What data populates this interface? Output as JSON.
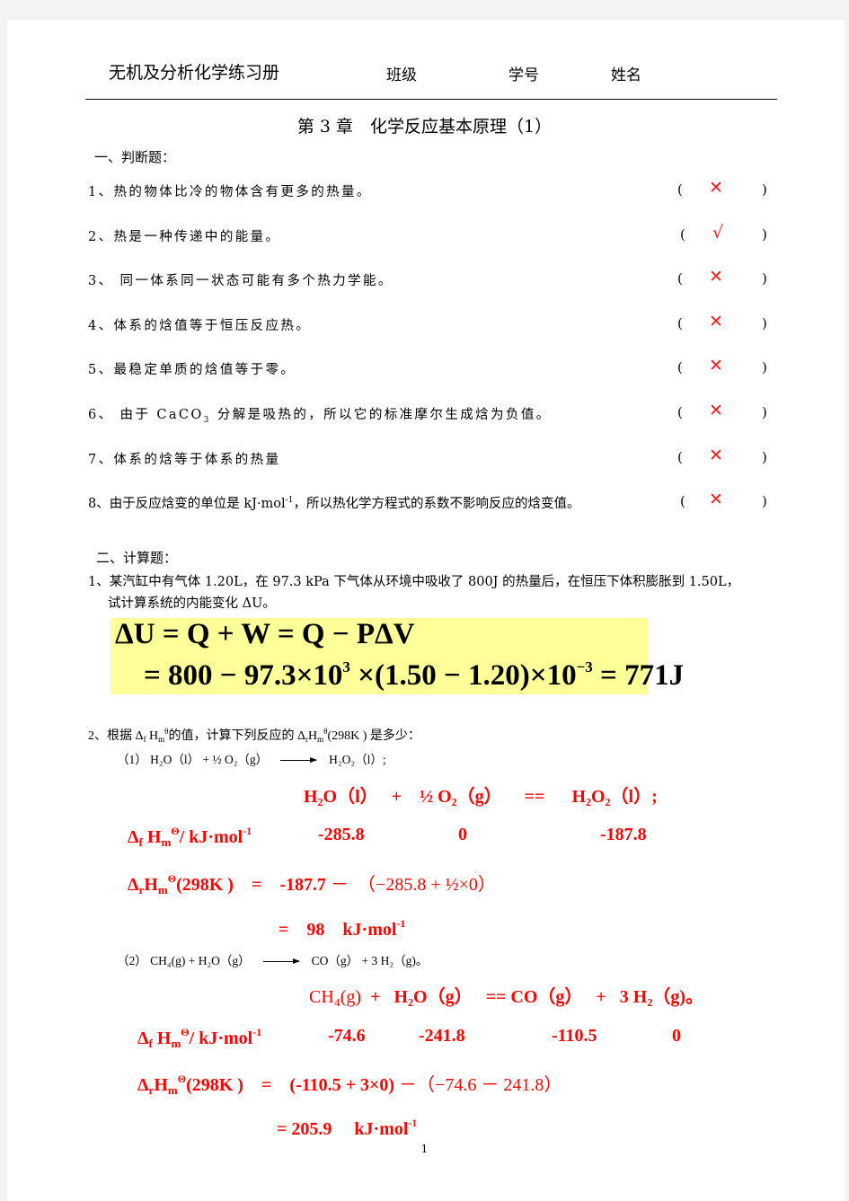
{
  "header": {
    "book_title": "无机及分析化学练习册",
    "class_label": "班级",
    "student_id_label": "学号",
    "name_label": "姓名"
  },
  "chapter_title": "第 3 章　化学反应基本原理（1）",
  "section1": {
    "title": "一、判断题：",
    "items": [
      {
        "num": "1、",
        "text": "热的物体比冷的物体含有更多的热量。",
        "answer": "✕",
        "answer_type": "wrong"
      },
      {
        "num": "2、",
        "text": "热是一种传递中的能量。",
        "answer": "√",
        "answer_type": "right"
      },
      {
        "num": "3、",
        "text": " 同一体系同一状态可能有多个热力学能。",
        "answer": "✕",
        "answer_type": "wrong"
      },
      {
        "num": "4、",
        "text": "体系的焓值等于恒压反应热。",
        "answer": "✕",
        "answer_type": "wrong"
      },
      {
        "num": "5、",
        "text": "最稳定单质的焓值等于零。",
        "answer": "✕",
        "answer_type": "wrong"
      },
      {
        "num": "6、",
        "text_pre": " 由于 CaCO",
        "text_sub": "3",
        "text_post": " 分解是吸热的，所以它的标准摩尔生成焓为负值。",
        "answer": "✕",
        "answer_type": "wrong"
      },
      {
        "num": "7、",
        "text": "体系的焓等于体系的热量",
        "answer": "✕",
        "answer_type": "wrong"
      },
      {
        "num": "8、",
        "text_pre": "由于反应焓变的单位是 kJ·mol",
        "text_sup": "-1",
        "text_post": "，所以热化学方程式的系数不影响反应的焓变值。",
        "answer": "✕",
        "answer_type": "wrong"
      }
    ],
    "paren_open": "(",
    "paren_close": ")"
  },
  "section2": {
    "title": "二、计算题：",
    "q1": {
      "line1": "1、某汽缸中有气体 1.20L，在 97.3  kPa 下气体从环境中吸收了 800J 的热量后，在恒压下体积膨胀到 1.50L，",
      "line2": "试计算系统的内能变化 ΔU。",
      "answer_line1": "ΔU = Q + W = Q − PΔV",
      "answer_line2_a": "= 800 − 97.3×10",
      "answer_line2_exp1": "3",
      "answer_line2_b": " ×(1.50 − 1.20)×10",
      "answer_line2_exp2": "−3",
      "answer_line2_c": " = 771J"
    },
    "q2": {
      "intro_a": "2、根据 Δ",
      "intro_f": "f",
      "intro_b": " H",
      "intro_m": "m",
      "intro_theta": "θ",
      "intro_c": "的值，计算下列反应的 Δ",
      "intro_r": "r",
      "intro_d": "H",
      "intro_e": "(298K )  是多少：",
      "part1": {
        "label": "（1）",
        "reactant1": "H₂O（l）",
        "plus": "+ ½ O₂（g）",
        "product": "H₂O₂（l）;",
        "answer_equation": {
          "r1": "H₂O（l）",
          "plus1": "+",
          "r2": "½ O₂（g）",
          "eq": "==",
          "p1": "H₂O₂（l）;"
        },
        "dfhm_label": "/ kJ·mol",
        "values": [
          "-285.8",
          "0",
          "-187.8"
        ],
        "calc_a": "-187.7",
        "calc_b": "－　（−285.8 + ½×0）",
        "result": "=　98　kJ·mol",
        "eq_sign": "="
      },
      "part2": {
        "label": "（2）",
        "question_lhs": "CH₄(g) +  H₂O（g）",
        "question_rhs": "CO（g）  + 3 H₂（g)。",
        "answer_equation": {
          "r1": "CH₄(g)",
          "plus1": "+",
          "r2": "H₂O（g）",
          "eq": "== CO（g）",
          "plus2": "+",
          "p2": "3 H₂（g)。"
        },
        "dfhm_label": "/ kJ·mol",
        "values": [
          "-74.6",
          "-241.8",
          "-110.5",
          "0"
        ],
        "calc_a": "(-110.5 + 3×0)",
        "calc_b": "－（−74.6 － 241.8）",
        "result": "= 205.9　 kJ·mol",
        "eq_sign": "="
      }
    }
  },
  "common": {
    "delta": "Δ",
    "H": "H",
    "sub_f": "f",
    "sub_r": "r",
    "sub_m": "m",
    "theta": "Θ",
    "temp": "(298K )",
    "exp_minus1": "-1"
  },
  "page_number": "1",
  "colors": {
    "answer_red": "#ff0000",
    "highlight_yellow": "#ffff99"
  }
}
